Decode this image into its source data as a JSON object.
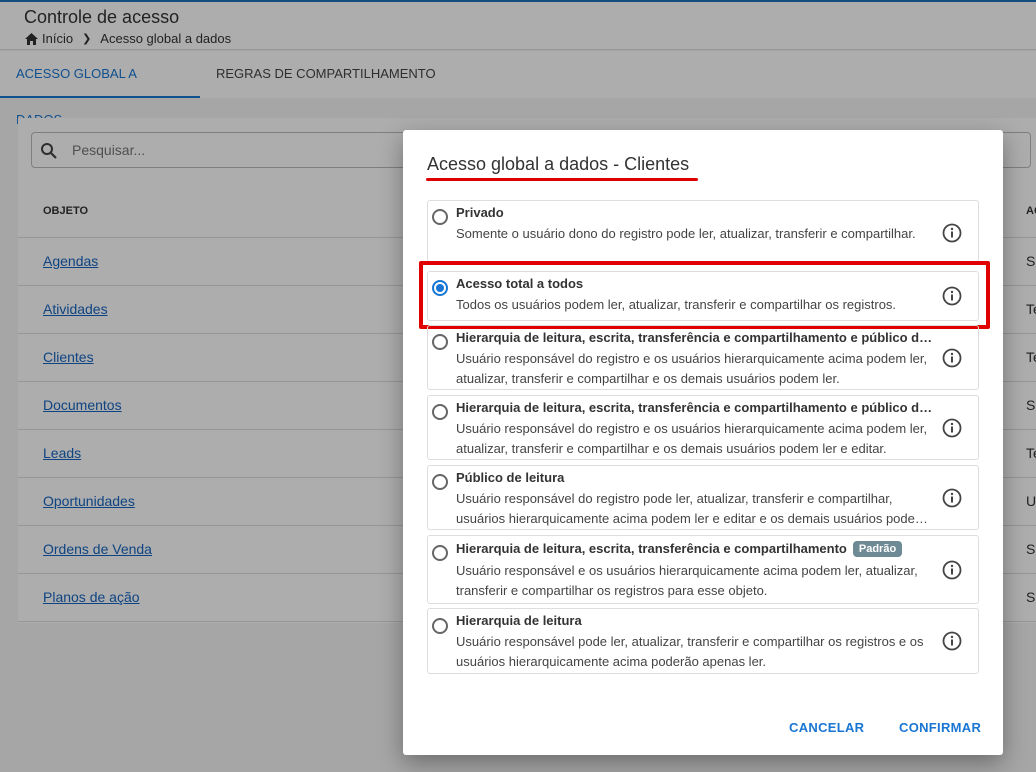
{
  "header": {
    "title": "Controle de acesso",
    "breadcrumb": [
      "Início",
      "Acesso global a dados"
    ]
  },
  "tabs": [
    {
      "label": "Acesso global a dados",
      "active": true
    },
    {
      "label": "Regras de compartilhamento",
      "active": false
    }
  ],
  "search": {
    "placeholder": "Pesquisar..."
  },
  "table": {
    "columns": [
      "OBJETO",
      "AC"
    ],
    "rows": [
      {
        "object": "Agendas",
        "access": "Se"
      },
      {
        "object": "Atividades",
        "access": "Te"
      },
      {
        "object": "Clientes",
        "access": "Te"
      },
      {
        "object": "Documentos",
        "access": "Se"
      },
      {
        "object": "Leads",
        "access": "Te"
      },
      {
        "object": "Oportunidades",
        "access": "U"
      },
      {
        "object": "Ordens de Venda",
        "access": "Se"
      },
      {
        "object": "Planos de ação",
        "access": "Se"
      }
    ]
  },
  "modal": {
    "title": "Acesso global a dados - Clientes",
    "options": [
      {
        "title": "Privado",
        "description": "Somente o usuário dono do registro pode ler, atualizar, transferir e compartilhar.",
        "checked": false
      },
      {
        "title": "Acesso total a todos",
        "description": "Todos os usuários podem ler, atualizar, transferir e compartilhar os registros.",
        "checked": true
      },
      {
        "title": "Hierarquia de leitura, escrita, transferência e compartilhamento e público de leitura",
        "description": "Usuário responsável do registro e os usuários hierarquicamente acima podem ler, atualizar, transferir e compartilhar e os demais usuários podem ler.",
        "checked": false
      },
      {
        "title": "Hierarquia de leitura, escrita, transferência e compartilhamento e público de escrita",
        "description": "Usuário responsável do registro e os usuários hierarquicamente acima podem ler, atualizar, transferir e compartilhar e os demais usuários podem ler e editar.",
        "checked": false
      },
      {
        "title": "Público de leitura",
        "description": "Usuário responsável do registro pode ler, atualizar, transferir e compartilhar, usuários hierarquicamente acima podem ler e editar e os demais usuários podem ler.",
        "checked": false
      },
      {
        "title": "Hierarquia de leitura, escrita, transferência e compartilhamento",
        "badge": "Padrão",
        "description": "Usuário responsável e os usuários hierarquicamente acima podem ler, atualizar, transferir e compartilhar os registros para esse objeto.",
        "checked": false
      },
      {
        "title": "Hierarquia de leitura",
        "description": "Usuário responsável pode ler, atualizar, transferir e compartilhar os registros e os usuários hierarquicamente acima poderão apenas ler.",
        "checked": false
      }
    ],
    "cancel_label": "Cancelar",
    "confirm_label": "Confirmar"
  },
  "colors": {
    "accent": "#1976d2",
    "highlight": "#e00000",
    "badge": "#6e8a94"
  }
}
